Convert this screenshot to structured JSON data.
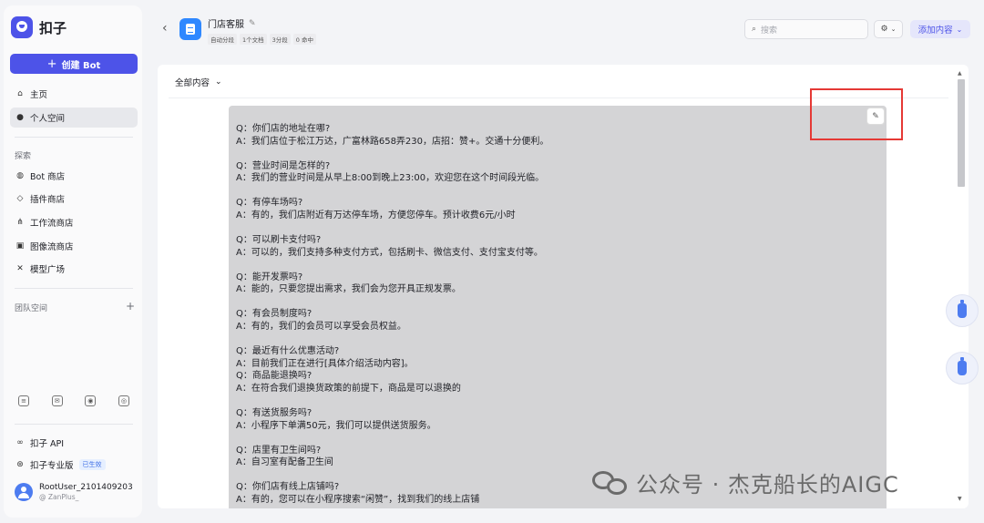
{
  "sidebar": {
    "brand": "扣子",
    "create_label": "创建 Bot",
    "create_plus": "+",
    "main_items": [
      {
        "label": "主页",
        "icon": "home-icon"
      },
      {
        "label": "个人空间",
        "icon": "person-icon"
      }
    ],
    "explore_label": "探索",
    "explore_items": [
      {
        "label": "Bot 商店",
        "icon": "bot-icon"
      },
      {
        "label": "插件商店",
        "icon": "cube-icon"
      },
      {
        "label": "工作流商店",
        "icon": "workflow-icon"
      },
      {
        "label": "图像流商店",
        "icon": "image-icon"
      },
      {
        "label": "模型广场",
        "icon": "model-icon"
      }
    ],
    "team_label": "团队空间",
    "team_plus": "+",
    "api_label": "扣子 API",
    "pro_label": "扣子专业版",
    "pro_badge": "已生效",
    "user_name": "RootUser_2101409203",
    "user_sub": "@ ZanPlus_"
  },
  "header": {
    "title": "门店客服",
    "tags": [
      "自动分段",
      "1个文档",
      "3分段",
      "0 命中"
    ],
    "search_placeholder": "搜索",
    "add_label": "添加内容"
  },
  "main": {
    "filter_label": "全部内容",
    "qa": [
      {
        "lines": [
          "Q：你们店的地址在哪?",
          "A：我们店位于松江万达，广富林路658弄230，店招：赞+。交通十分便利。"
        ]
      },
      {
        "lines": [
          "Q：营业时间是怎样的?",
          "A：我们的营业时间是从早上8:00到晚上23:00，欢迎您在这个时间段光临。"
        ]
      },
      {
        "lines": [
          "Q：有停车场吗?",
          "A：有的，我们店附近有万达停车场，方便您停车。预计收费6元/小时"
        ]
      },
      {
        "lines": [
          "Q：可以刷卡支付吗?",
          "A：可以的，我们支持多种支付方式，包括刷卡、微信支付、支付宝支付等。"
        ]
      },
      {
        "lines": [
          "Q：能开发票吗?",
          "A：能的，只要您提出需求，我们会为您开具正规发票。"
        ]
      },
      {
        "lines": [
          "Q：有会员制度吗?",
          "A：有的，我们的会员可以享受会员权益。"
        ]
      },
      {
        "lines": [
          "Q：最近有什么优惠活动?",
          "A：目前我们正在进行[具体介绍活动内容]。",
          "Q：商品能退换吗?",
          "A：在符合我们退换货政策的前提下，商品是可以退换的"
        ]
      },
      {
        "lines": [
          "Q：有送货服务吗?",
          "A：小程序下单满50元，我们可以提供送货服务。"
        ]
      },
      {
        "lines": [
          "Q：店里有卫生间吗?",
          "A：自习室有配备卫生间"
        ]
      },
      {
        "lines": [
          "Q：你们店有线上店铺吗?",
          "A：有的，您可以在小程序搜索“闲赞”，找到我们的线上店铺"
        ]
      }
    ]
  },
  "watermark": "公众号 · 杰克船长的AIGC",
  "colors": {
    "accent": "#4d53e8",
    "kb_blue": "#2f88ff",
    "highlight_red": "#e53935"
  }
}
